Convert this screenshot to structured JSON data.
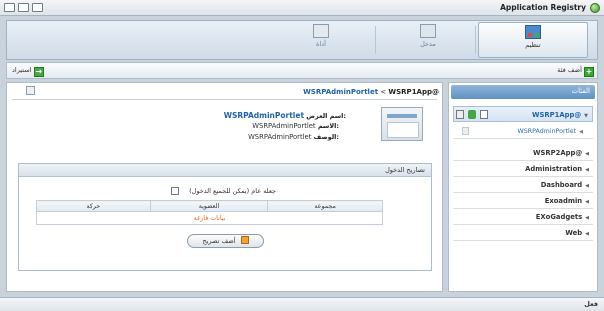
{
  "window": {
    "title": "Application Registry"
  },
  "toolbar": {
    "items": [
      {
        "label": "تنظيم",
        "icon": "organize-icon"
      },
      {
        "label": "مدخل",
        "icon": "portlet-icon"
      },
      {
        "label": "أداة",
        "icon": "gadget-icon"
      }
    ]
  },
  "subbar": {
    "add_category": "أضف فئة",
    "import": "استيراد"
  },
  "breadcrumb": {
    "part1": "WSRP1App@",
    "separator": "<",
    "part2": "WSRPAdminPortlet"
  },
  "portlet_info": {
    "display_name_label": "اسم العرض:",
    "display_name_value": "WSRPAdminPortlet",
    "name_label": "الاسم:",
    "name_value": "WSRPAdminPortlet",
    "description_label": "الوصف:",
    "description_value": "WSRPAdminPortlet"
  },
  "access_permission": {
    "title": "تصاريح الدخول",
    "public_checkbox_label": "(جعله عام (يمكن للجميع الدخول",
    "columns": [
      "مجموعة",
      "العضوية",
      "حركة"
    ],
    "empty_text": "بيانات فارغة",
    "add_permission": "أضف تصريح"
  },
  "sidebar": {
    "title": "الفئات",
    "categories": [
      {
        "label": "WSRP1App@",
        "selected": true
      },
      {
        "label": "WSRP2App@",
        "selected": false
      },
      {
        "label": "Administration",
        "selected": false
      },
      {
        "label": "Dashboard",
        "selected": false
      },
      {
        "label": "Exoadmin",
        "selected": false
      },
      {
        "label": "EXoGadgets",
        "selected": false
      },
      {
        "label": "Web",
        "selected": false
      }
    ],
    "selected_child": "WSRPAdminPortlet"
  },
  "status": {
    "text": "فعل"
  },
  "colors": {
    "accent": "#1f62a8",
    "empty": "#e26a12",
    "header_blue": "#5f90c1"
  }
}
